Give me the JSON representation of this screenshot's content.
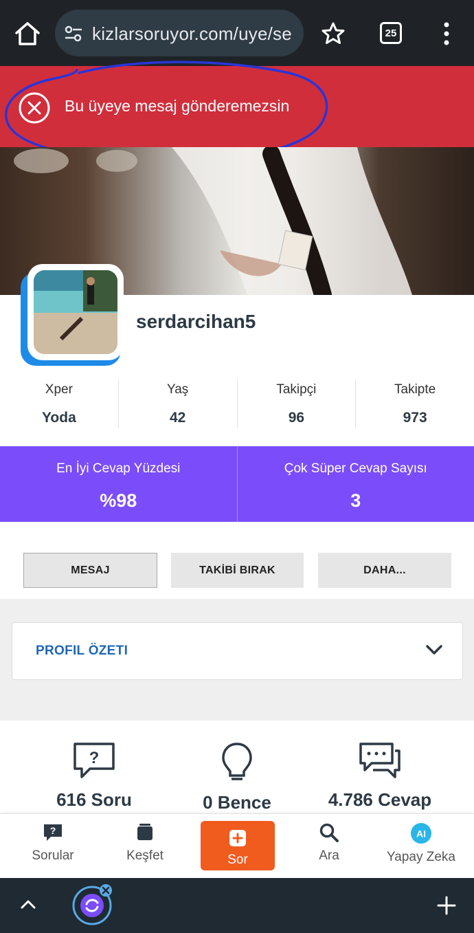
{
  "browser": {
    "url": "kizlarsoruyor.com/uye/se",
    "tab_count": "25"
  },
  "alert": {
    "message": "Bu üyeye mesaj gönderemezsin"
  },
  "profile": {
    "username": "serdarcihan5",
    "stats": [
      {
        "label": "Xper",
        "value": "Yoda"
      },
      {
        "label": "Yaş",
        "value": "42"
      },
      {
        "label": "Takipçi",
        "value": "96"
      },
      {
        "label": "Takipte",
        "value": "973"
      }
    ],
    "highlights": [
      {
        "label": "En İyi Cevap Yüzdesi",
        "value": "%98"
      },
      {
        "label": "Çok Süper Cevap Sayısı",
        "value": "3"
      }
    ]
  },
  "actions": {
    "message": "MESAJ",
    "unfollow": "TAKİBİ BIRAK",
    "more": "DAHA..."
  },
  "summary": {
    "label": "PROFIL ÖZETI"
  },
  "counts": [
    {
      "text": "616 Soru",
      "icon": "question-bubble-icon"
    },
    {
      "text": "0 Bence",
      "icon": "lightbulb-icon"
    },
    {
      "text": "4.786 Cevap",
      "icon": "answers-bubble-icon"
    }
  ],
  "site_nav": [
    {
      "label": "Sorular",
      "icon": "question-icon"
    },
    {
      "label": "Keşfet",
      "icon": "cards-icon"
    },
    {
      "label": "Sor",
      "icon": "plus-icon"
    },
    {
      "label": "Ara",
      "icon": "search-icon"
    },
    {
      "label": "Yapay Zeka",
      "icon": "ai-icon"
    }
  ],
  "colors": {
    "alert": "#d12e3c",
    "purple": "#7b4dfa",
    "accent_blue": "#1f67b8",
    "sor_orange": "#f05b1e",
    "annotation": "#2a35d6"
  }
}
